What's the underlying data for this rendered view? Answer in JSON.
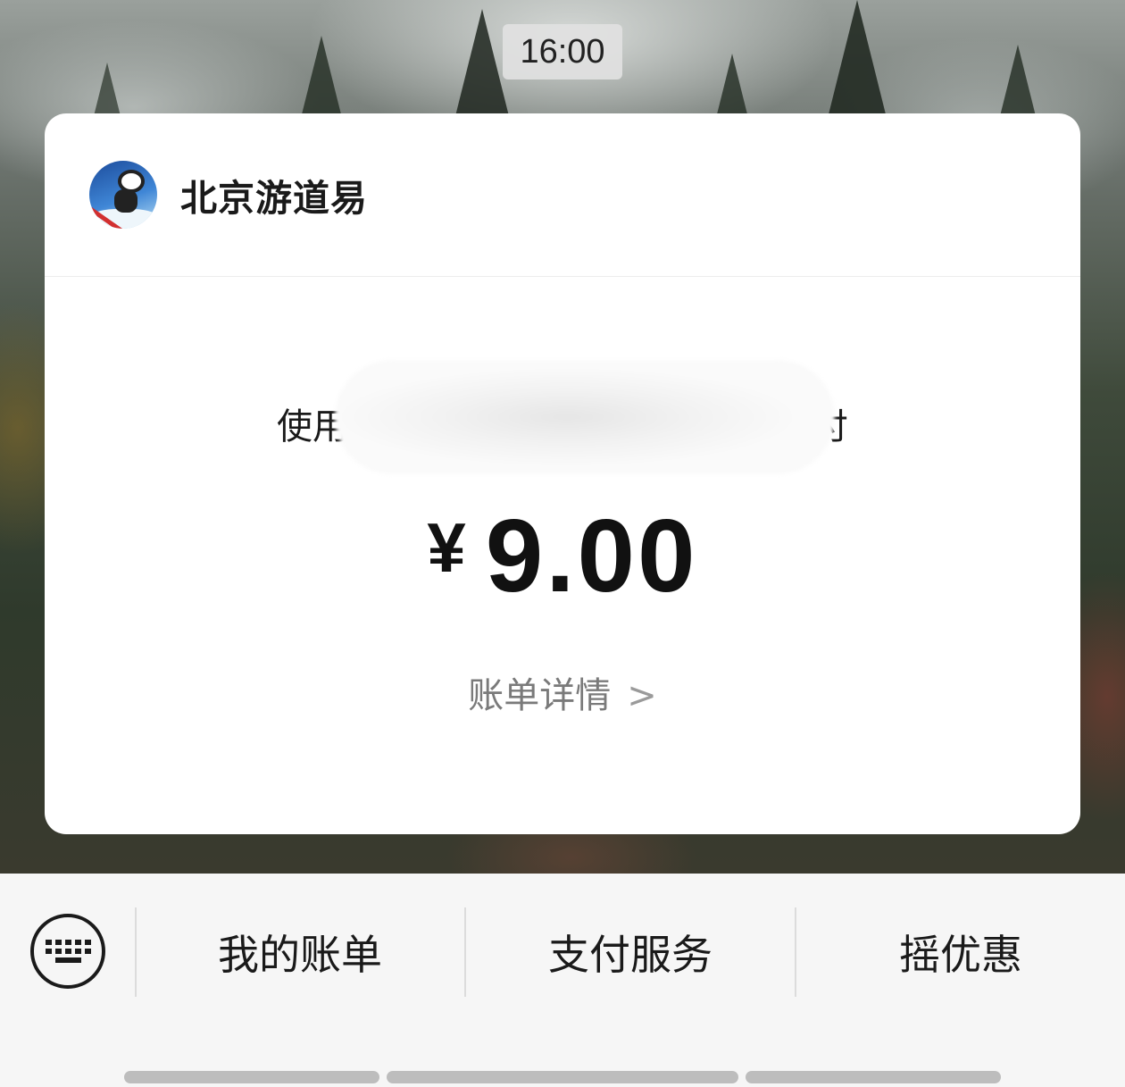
{
  "status": {
    "time": "16:00"
  },
  "card": {
    "merchant_name": "北京游道易",
    "pay_method_prefix": "使用",
    "pay_method_suffix": "付",
    "currency": "¥",
    "amount": "9.00",
    "bill_detail_label": "账单详情",
    "bill_detail_chevron": ">"
  },
  "menu": {
    "items": [
      {
        "label": "我的账单"
      },
      {
        "label": "支付服务"
      },
      {
        "label": "摇优惠"
      }
    ]
  },
  "icons": {
    "keyboard": "keyboard-icon",
    "merchant": "merchant-avatar"
  }
}
